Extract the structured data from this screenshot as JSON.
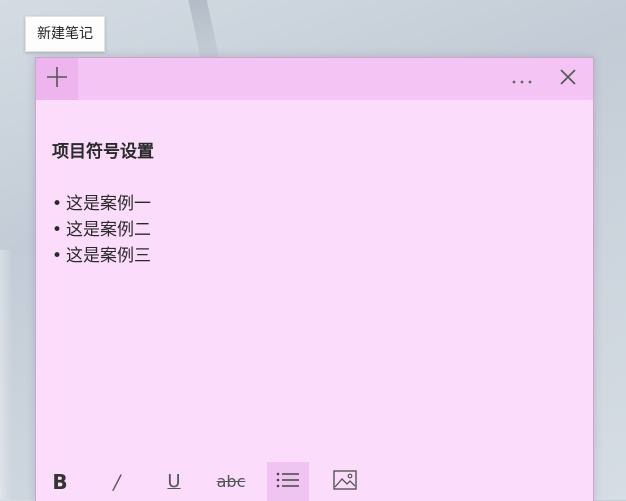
{
  "tooltip": {
    "text": "新建笔记"
  },
  "note": {
    "heading": "项目符号设置",
    "bullet_glyph": "•",
    "bullets": [
      "这是案例一",
      "这是案例二",
      "这是案例三"
    ],
    "background_color": "#fbdcfb",
    "titlebar_color": "#f4c4f4"
  },
  "titlebar": {
    "add_icon": "plus-icon",
    "more_icon": "ellipsis-icon",
    "close_icon": "close-icon"
  },
  "toolbar": {
    "bold_label": "B",
    "italic_label": "/",
    "underline_label": "U",
    "strike_label": "abc",
    "list_icon": "bulleted-list-icon",
    "image_icon": "image-icon",
    "active_tool": "bulleted-list"
  }
}
